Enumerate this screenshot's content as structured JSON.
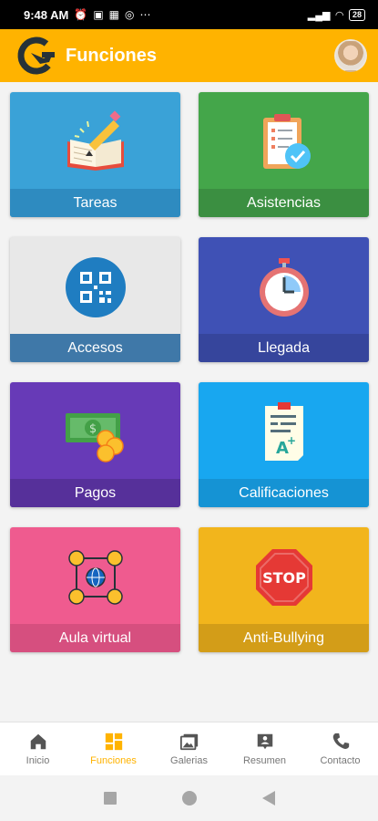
{
  "status_bar": {
    "time": "9:48 AM",
    "left_icons": [
      "alarm-icon",
      "calendar-icon",
      "gallery-icon",
      "whatsapp-icon",
      "more-icon"
    ],
    "battery": "28"
  },
  "app_bar": {
    "title": "Funciones"
  },
  "cards": [
    {
      "label": "Tareas",
      "color": "#3AA2D7",
      "label_color": "#2E8BC0",
      "icon": "book-pencil-icon"
    },
    {
      "label": "Asistencias",
      "color": "#44A64A",
      "label_color": "#3B8F41",
      "icon": "clipboard-check-icon"
    },
    {
      "label": "Accesos",
      "color": "#E8E8E8",
      "label_color": "#3F78A8",
      "icon": "qr-code-icon"
    },
    {
      "label": "Llegada",
      "color": "#3F51B5",
      "label_color": "#36459C",
      "icon": "stopwatch-icon"
    },
    {
      "label": "Pagos",
      "color": "#673AB7",
      "label_color": "#56309A",
      "icon": "money-icon"
    },
    {
      "label": "Calificaciones",
      "color": "#18A7F0",
      "label_color": "#1593D4",
      "icon": "grade-sheet-icon"
    },
    {
      "label": "Aula virtual",
      "color": "#EF5B8F",
      "label_color": "#D64F7F",
      "icon": "network-people-icon"
    },
    {
      "label": "Anti-Bullying",
      "color": "#F2B51C",
      "label_color": "#D39D18",
      "icon": "stop-sign-icon"
    }
  ],
  "bottom_nav": [
    {
      "label": "Inicio",
      "icon": "home-icon",
      "active": false
    },
    {
      "label": "Funciones",
      "icon": "dashboard-icon",
      "active": true
    },
    {
      "label": "Galerias",
      "icon": "gallery-icon",
      "active": false
    },
    {
      "label": "Resumen",
      "icon": "summary-icon",
      "active": false
    },
    {
      "label": "Contacto",
      "icon": "phone-icon",
      "active": false
    }
  ],
  "stop_text": "STOP",
  "accent_color": "#FFB300"
}
